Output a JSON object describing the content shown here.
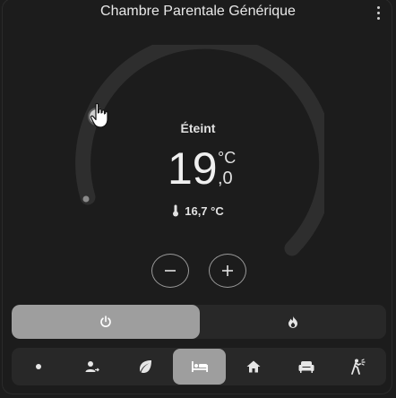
{
  "card": {
    "title": "Chambre Parentale Générique",
    "menu_icon": "more-vertical-icon"
  },
  "thermostat": {
    "status": "Éteint",
    "target_integer": "19",
    "target_decimal": ",0",
    "unit": "°C",
    "current_temperature": "16,7 °C",
    "current_icon": "thermometer-icon",
    "colors": {
      "arc": "#2e2e2e",
      "handle": "#bdbdbd",
      "dot": "#8a8a8a"
    }
  },
  "controls": {
    "decrease_icon": "minus-icon",
    "increase_icon": "plus-icon"
  },
  "modes": {
    "items": [
      {
        "icon": "power-icon",
        "selected": true
      },
      {
        "icon": "fire-icon",
        "selected": false
      }
    ],
    "colors": {
      "selected": "#9e9e9e",
      "background": "#282828"
    }
  },
  "presets": {
    "items": [
      {
        "icon": "dot-icon",
        "selected": false
      },
      {
        "icon": "account-arrow-icon",
        "selected": false
      },
      {
        "icon": "leaf-icon",
        "selected": false
      },
      {
        "icon": "bed-icon",
        "selected": true
      },
      {
        "icon": "home-icon",
        "selected": false
      },
      {
        "icon": "sofa-icon",
        "selected": false
      },
      {
        "icon": "walk-motion-icon",
        "selected": false
      }
    ]
  }
}
